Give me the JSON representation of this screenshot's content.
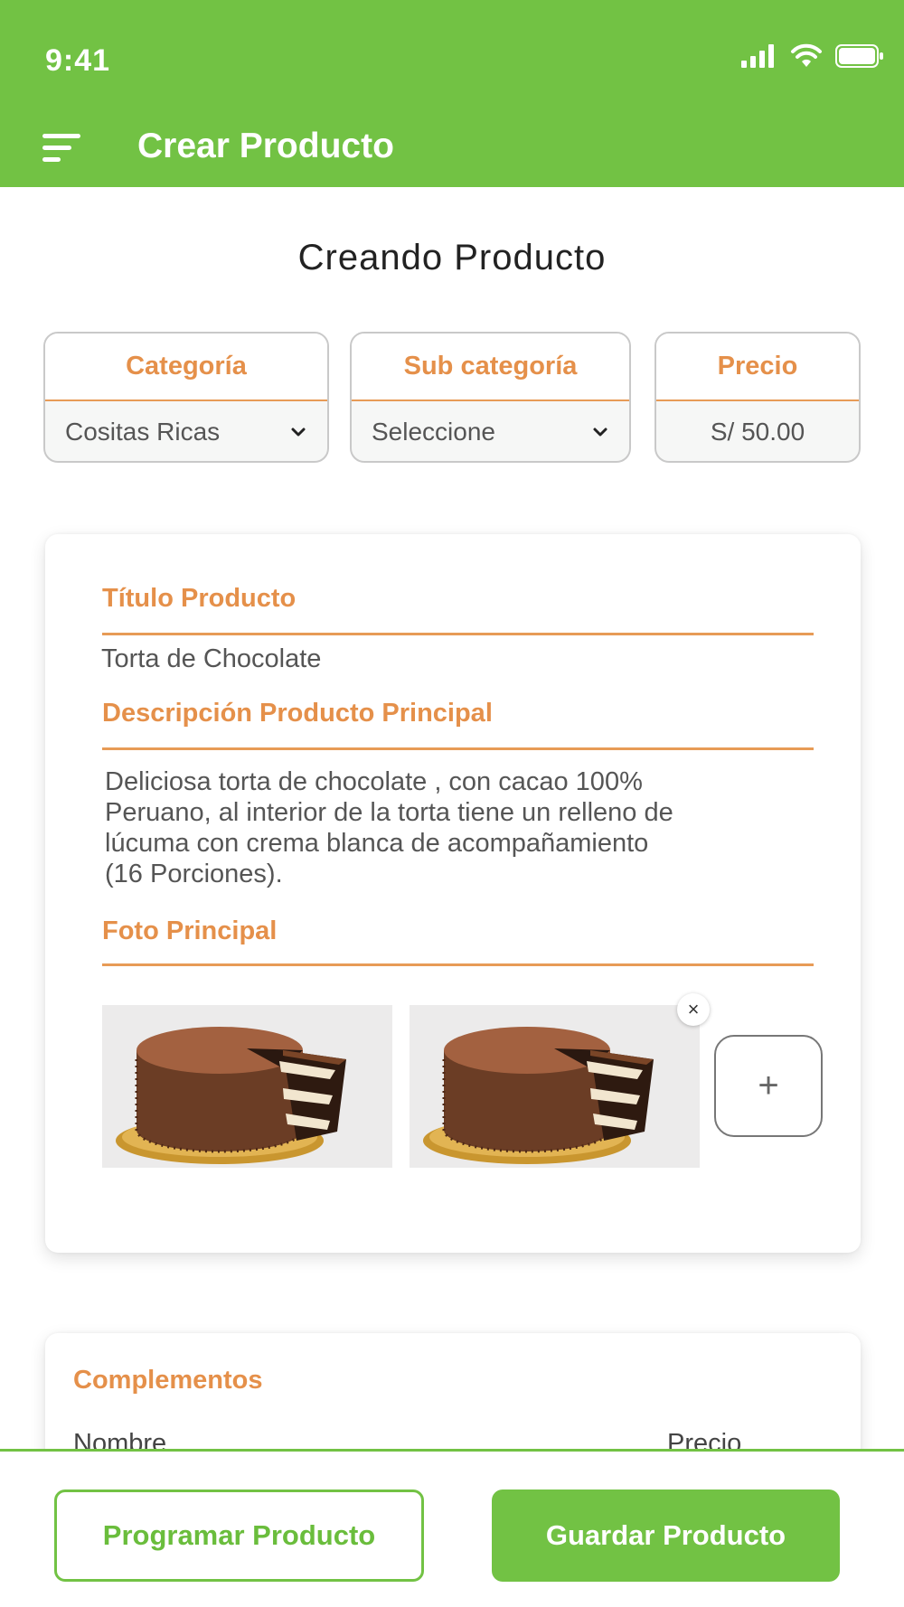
{
  "status_bar": {
    "time": "9:41"
  },
  "appbar": {
    "title": "Crear Producto",
    "menu_icon": "menu-icon"
  },
  "page_heading": "Creando Producto",
  "fields": {
    "categoria": {
      "label": "Categoría",
      "value": "Cositas Ricas"
    },
    "subcategoria": {
      "label": "Sub categoría",
      "value": "Seleccione"
    },
    "precio": {
      "label": "Precio",
      "value": "S/ 50.00"
    }
  },
  "product_card": {
    "title_label": "Título Producto",
    "title_value": "Torta de Chocolate",
    "description_label": "Descripción Producto  Principal",
    "description_lines": [
      "Deliciosa torta de chocolate , con cacao 100%",
      "Peruano, al interior de la torta tiene un relleno de",
      "lúcuma con crema blanca de acompañamiento",
      "(16 Porciones)."
    ],
    "photo_label": "Foto Principal",
    "remove_label": "×",
    "add_label": "+"
  },
  "complementos": {
    "title": "Complementos",
    "col_name": "Nombre",
    "col_price": "Precio"
  },
  "actions": {
    "schedule_label": "Programar Producto",
    "save_label": "Guardar Producto"
  },
  "colors": {
    "brand_green": "#72c244",
    "accent_orange": "#e5904a"
  }
}
